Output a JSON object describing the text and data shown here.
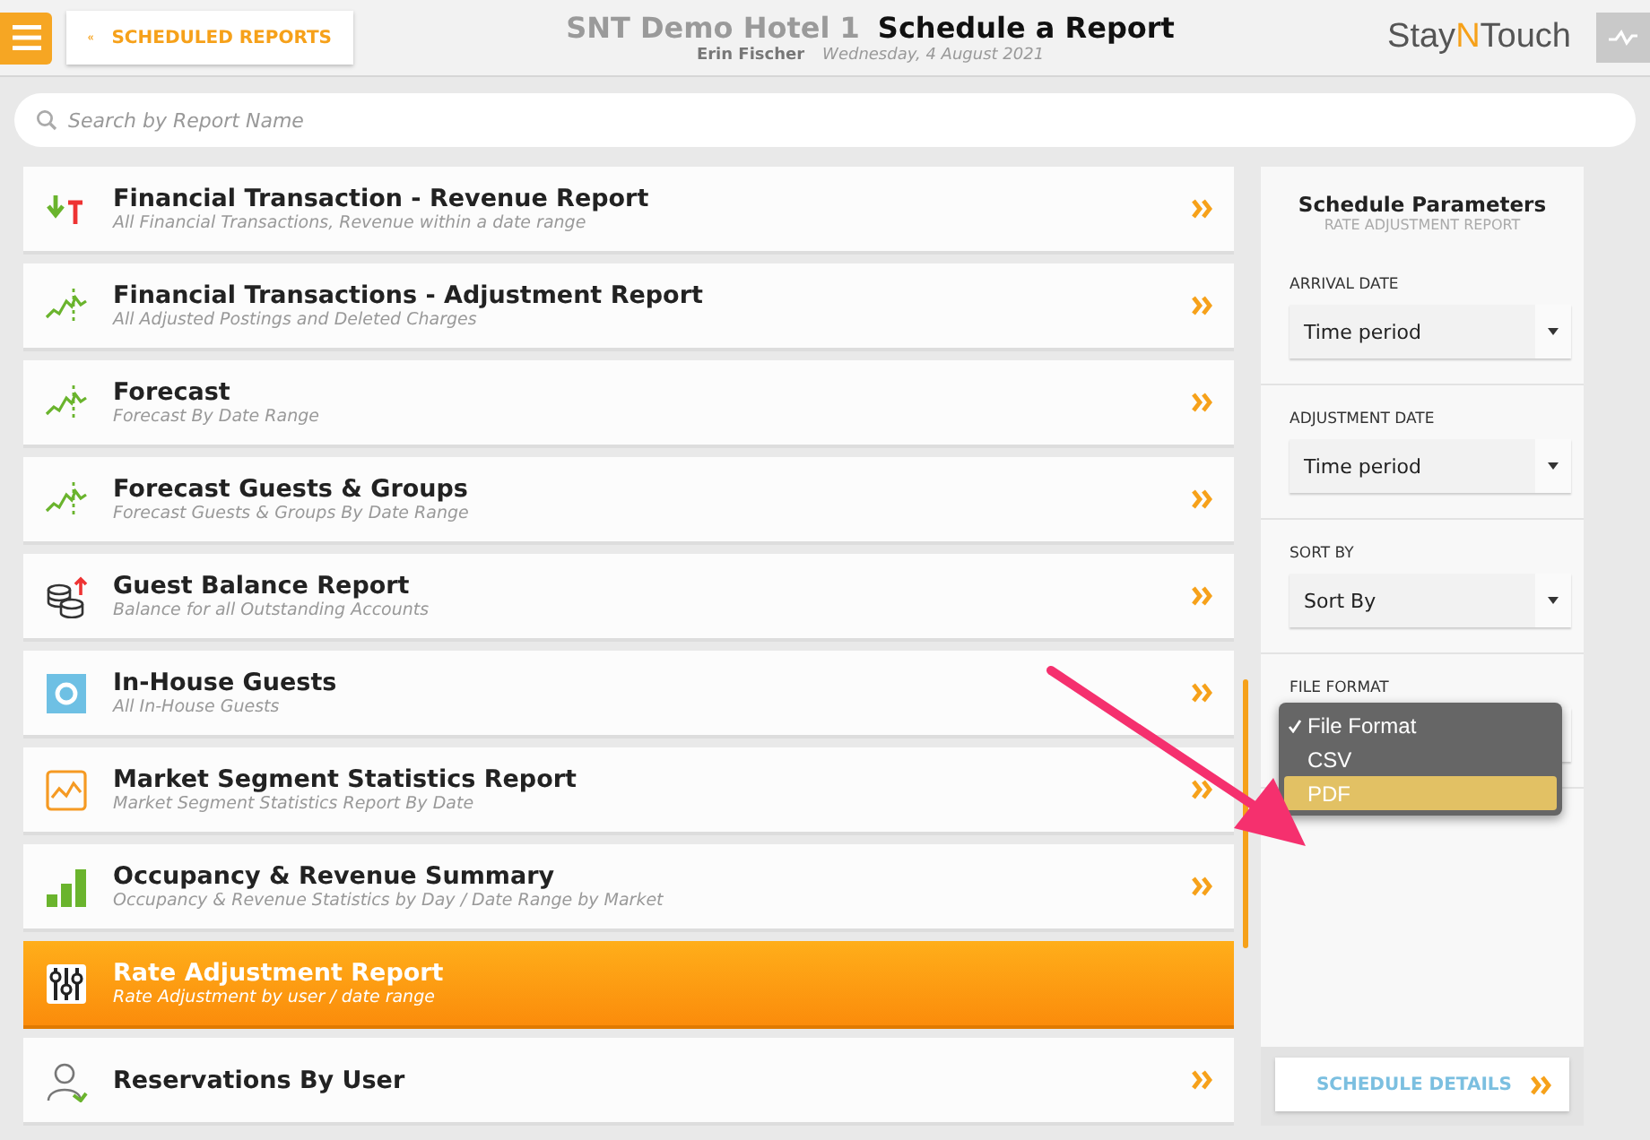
{
  "header": {
    "back_button": "SCHEDULED REPORTS",
    "hotel": "SNT Demo Hotel 1",
    "title": "Schedule a Report",
    "user": "Erin Fischer",
    "date": "Wednesday, 4 August 2021",
    "logo": {
      "before": "Stay",
      "accent": "N",
      "after": "Touch"
    }
  },
  "search": {
    "placeholder": "Search by Report Name"
  },
  "reports": [
    {
      "kind": "arrows",
      "title": "Financial Transaction - Revenue Report",
      "subtitle": "All Financial Transactions, Revenue within a date range",
      "selected": false
    },
    {
      "kind": "trend",
      "title": "Financial Transactions - Adjustment Report",
      "subtitle": "All Adjusted Postings and Deleted Charges",
      "selected": false
    },
    {
      "kind": "trend",
      "title": "Forecast",
      "subtitle": "Forecast By Date Range",
      "selected": false
    },
    {
      "kind": "trend",
      "title": "Forecast Guests & Groups",
      "subtitle": "Forecast Guests & Groups By Date Range",
      "selected": false
    },
    {
      "kind": "coins",
      "title": "Guest Balance Report",
      "subtitle": "Balance for all Outstanding Accounts",
      "selected": false
    },
    {
      "kind": "circle",
      "title": "In-House Guests",
      "subtitle": "All In-House Guests",
      "selected": false
    },
    {
      "kind": "linechart",
      "title": "Market Segment Statistics Report",
      "subtitle": "Market Segment Statistics Report By Date",
      "selected": false
    },
    {
      "kind": "bars",
      "title": "Occupancy & Revenue Summary",
      "subtitle": "Occupancy & Revenue Statistics by Day / Date Range by Market",
      "selected": false
    },
    {
      "kind": "sliders",
      "title": "Rate Adjustment Report",
      "subtitle": "Rate Adjustment by user / date range",
      "selected": true
    },
    {
      "kind": "user",
      "title": "Reservations By User",
      "selected": false
    }
  ],
  "parameters": {
    "title": "Schedule Parameters",
    "subtitle": "RATE ADJUSTMENT REPORT",
    "fields": [
      {
        "label": "ARRIVAL DATE",
        "value": "Time period"
      },
      {
        "label": "ADJUSTMENT DATE",
        "value": "Time period"
      },
      {
        "label": "SORT BY",
        "value": "Sort By"
      },
      {
        "label": "FILE FORMAT"
      }
    ],
    "file_format_menu": [
      {
        "label": "File Format",
        "checked": true,
        "selected": false
      },
      {
        "label": "CSV",
        "checked": false,
        "selected": false
      },
      {
        "label": "PDF",
        "checked": false,
        "selected": true
      }
    ],
    "schedule_button": "SCHEDULE DETAILS"
  }
}
